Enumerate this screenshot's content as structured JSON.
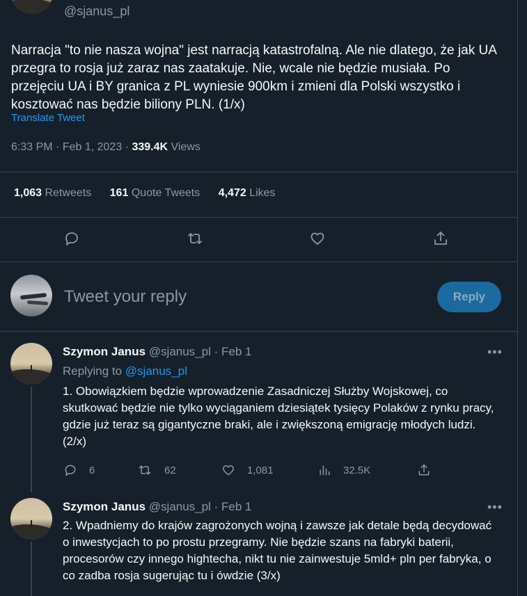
{
  "tweet": {
    "handle": "@sjanus_pl",
    "text": "Narracja \"to nie nasza wojna\" jest narracją katastrofalną. Ale nie dlatego, że jak UA przegra to rosja już zaraz nas zaatakuje. Nie, wcale nie będzie musiała. Po przejęciu UA i BY granica z PL wyniesie 900km i zmieni dla Polski wszystko i kosztować nas będzie biliony PLN. (1/x)",
    "translate_label": "Translate Tweet",
    "time": "6:33 PM",
    "date": "Feb 1, 2023",
    "views_count": "339.4K",
    "views_label": "Views",
    "retweets_count": "1,063",
    "retweets_label": "Retweets",
    "quotes_count": "161",
    "quotes_label": "Quote Tweets",
    "likes_count": "4,472",
    "likes_label": "Likes"
  },
  "reply_box": {
    "placeholder": "Tweet your reply",
    "button_label": "Reply"
  },
  "replies": [
    {
      "name": "Szymon Janus",
      "handle": "@sjanus_pl",
      "date": "Feb 1",
      "replying_prefix": "Replying to",
      "replying_to": "@sjanus_pl",
      "text": "1. Obowiązkiem będzie wprowadzenie Zasadniczej Służby Wojskowej, co skutkować będzie nie tylko wyciąganiem dziesiątek tysięcy Polaków z rynku pracy, gdzie już teraz są gigantyczne braki, ale i zwiększoną emigrację młodych ludzi. (2/x)",
      "replies": "6",
      "retweets": "62",
      "likes": "1,081",
      "views": "32.5K"
    },
    {
      "name": "Szymon Janus",
      "handle": "@sjanus_pl",
      "date": "Feb 1",
      "text": "2. Wpadniemy do krajów zagrożonych wojną i zawsze jak detale będą decydować o inwestycjach to po prostu przegramy. Nie będzie szans na fabryki baterii, procesorów czy innego hightecha, nikt tu nie zainwestuje 5mld+ pln per fabryka, o co zadba rosja sugerując tu i ówdzie (3/x)"
    }
  ],
  "separators": {
    "dot": " · ",
    "more": "•••"
  },
  "colors": {
    "background": "#15202b",
    "border": "#38444d",
    "accent": "#1d9bf0",
    "muted_text": "#8b98a5"
  },
  "icons": [
    "reply-icon",
    "retweet-icon",
    "like-icon",
    "share-icon",
    "views-icon",
    "more-icon"
  ]
}
